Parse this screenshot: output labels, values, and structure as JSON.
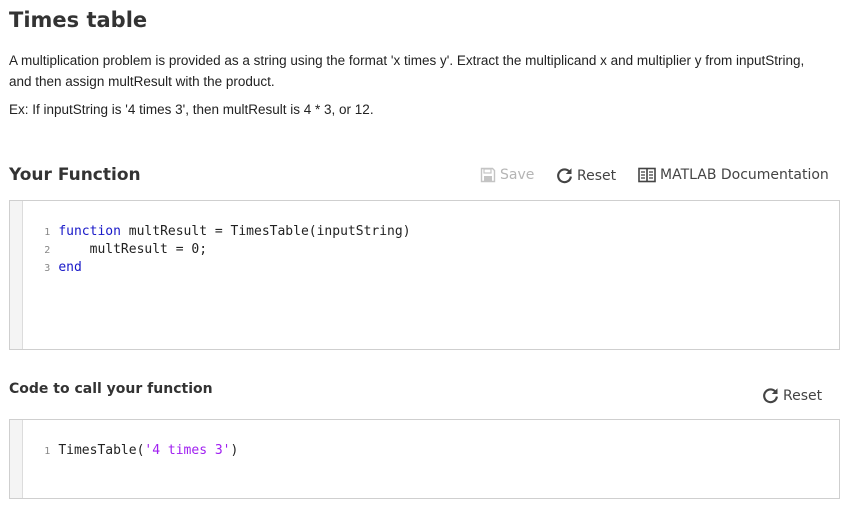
{
  "problem": {
    "title": "Times table",
    "description": "A multiplication problem is provided as a string using the format 'x times y'. Extract the multiplicand x and multiplier y from inputString, and then assign multResult with the product.",
    "example": "Ex: If inputString is '4 times 3', then multResult is 4 * 3, or 12."
  },
  "function_section": {
    "title": "Your Function",
    "save_label": "Save",
    "reset_label": "Reset",
    "docs_label": "MATLAB Documentation",
    "lines": [
      {
        "num": "1",
        "keyword": "function",
        "rest": " multResult = TimesTable(inputString)"
      },
      {
        "num": "2",
        "text": "    multResult = 0;"
      },
      {
        "num": "3",
        "keyword": "end"
      }
    ]
  },
  "call_section": {
    "title": "Code to call your function",
    "reset_label": "Reset",
    "line": {
      "num": "1",
      "prefix": "TimesTable(",
      "string": "'4 times 3'",
      "suffix": ")"
    }
  },
  "colors": {
    "keyword": "#1818c8",
    "string": "#a020f0",
    "disabled": "#b5b5b5"
  }
}
